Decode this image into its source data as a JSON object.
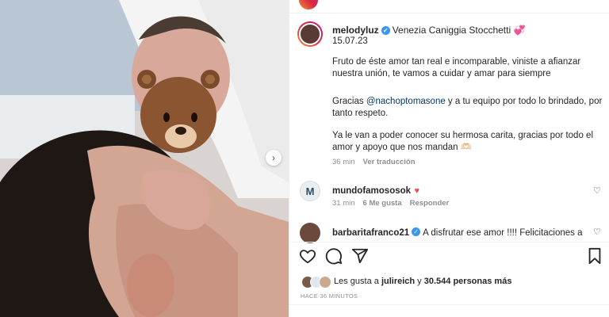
{
  "post": {
    "username": "melodyluz",
    "header_rest": "Venezia Caniggia Stocchetti",
    "header_emoji": "💞",
    "date": "15.07.23",
    "caption_p1": "Fruto de éste amor tan real e incomparable, viniste a afianzar nuestra unión, te vamos a cuidar y amar para siempre",
    "caption_p2_before": "Gracias ",
    "caption_p2_mention": "@nachoptomasone",
    "caption_p2_after": " y a tu equipo por todo lo brindado, por tanto respeto.",
    "caption_p3": "Ya le van a poder conocer su hermosa carita, gracias por todo el amor y apoyo que nos mandan 🫶🏻",
    "time": "36 min",
    "translate": "Ver traducción"
  },
  "comments": [
    {
      "username": "mundofamososok",
      "avatar_letter": "M",
      "text": "",
      "emoji": "♥",
      "time": "31 min",
      "likes": "6 Me gusta",
      "reply": "Responder"
    },
    {
      "username": "barbaritafranco21",
      "text": "A disfrutar ese amor !!!! Felicitaciones a"
    }
  ],
  "likes": {
    "prefix": "Les gusta a ",
    "user": "julireich",
    "middle": " y ",
    "count": "30.544 personas más"
  },
  "ago": "HACE 36 MINUTOS",
  "colors": {
    "accent": "#0095f6",
    "verified": "#3897f0",
    "red_heart": "#ed4956",
    "muted": "#8e8e8e"
  },
  "icons": [
    "heart-icon",
    "comment-icon",
    "share-icon",
    "bookmark-icon",
    "chevron-right-icon",
    "verified-icon"
  ]
}
